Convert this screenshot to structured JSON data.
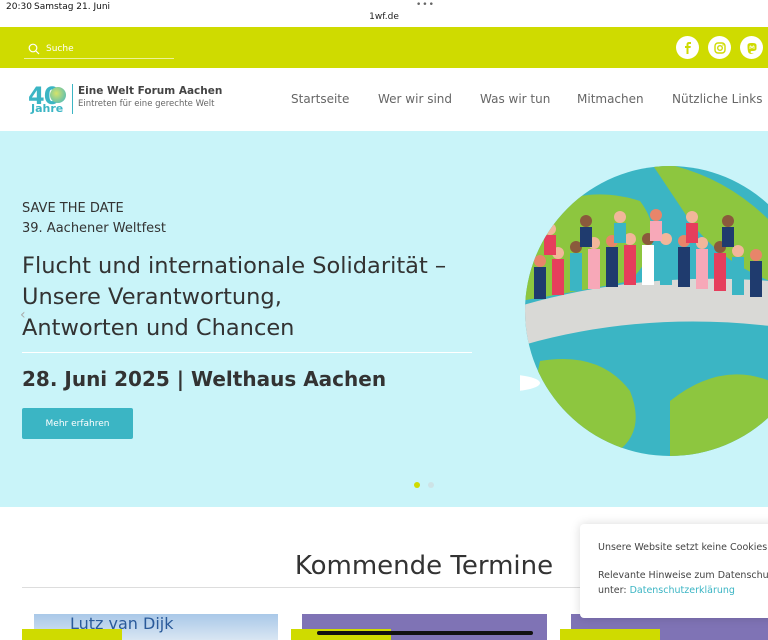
{
  "statusbar": {
    "time": "20:30",
    "date": "Samstag 21. Juni",
    "url": "1wf.de"
  },
  "topbar": {
    "search_placeholder": "Suche",
    "social": [
      "facebook-icon",
      "instagram-icon",
      "mastodon-icon"
    ]
  },
  "logo": {
    "number": "40",
    "jahre": "Jahre",
    "title": "Eine Welt Forum Aachen",
    "subtitle": "Eintreten für eine gerechte Welt"
  },
  "nav": {
    "items": [
      "Startseite",
      "Wer wir sind",
      "Was wir tun",
      "Mitmachen",
      "Nützliche Links"
    ]
  },
  "hero": {
    "kicker1": "SAVE THE DATE",
    "kicker2": "39. Aachener Weltfest",
    "headline_line1": "Flucht und internationale Solidarität –",
    "headline_line2": "Unsere Verantwortung,",
    "headline_line3": "Antworten und Chancen",
    "dateline": "28. Juni 2025 | Welthaus Aachen",
    "button": "Mehr erfahren"
  },
  "section": {
    "title": "Kommende Termine"
  },
  "cards": {
    "card1_text": "Lutz van Dijk"
  },
  "cookie": {
    "line1": "Unsere Website setzt keine Cookies.",
    "line2": "Relevante Hinweise zum Datenschutz",
    "line3_prefix": "unter: ",
    "line3_link": "Datenschutzerklärung"
  },
  "colors": {
    "accent_lime": "#cfdb00",
    "accent_teal": "#3bb5c4",
    "hero_bg": "#c9f4f9"
  }
}
